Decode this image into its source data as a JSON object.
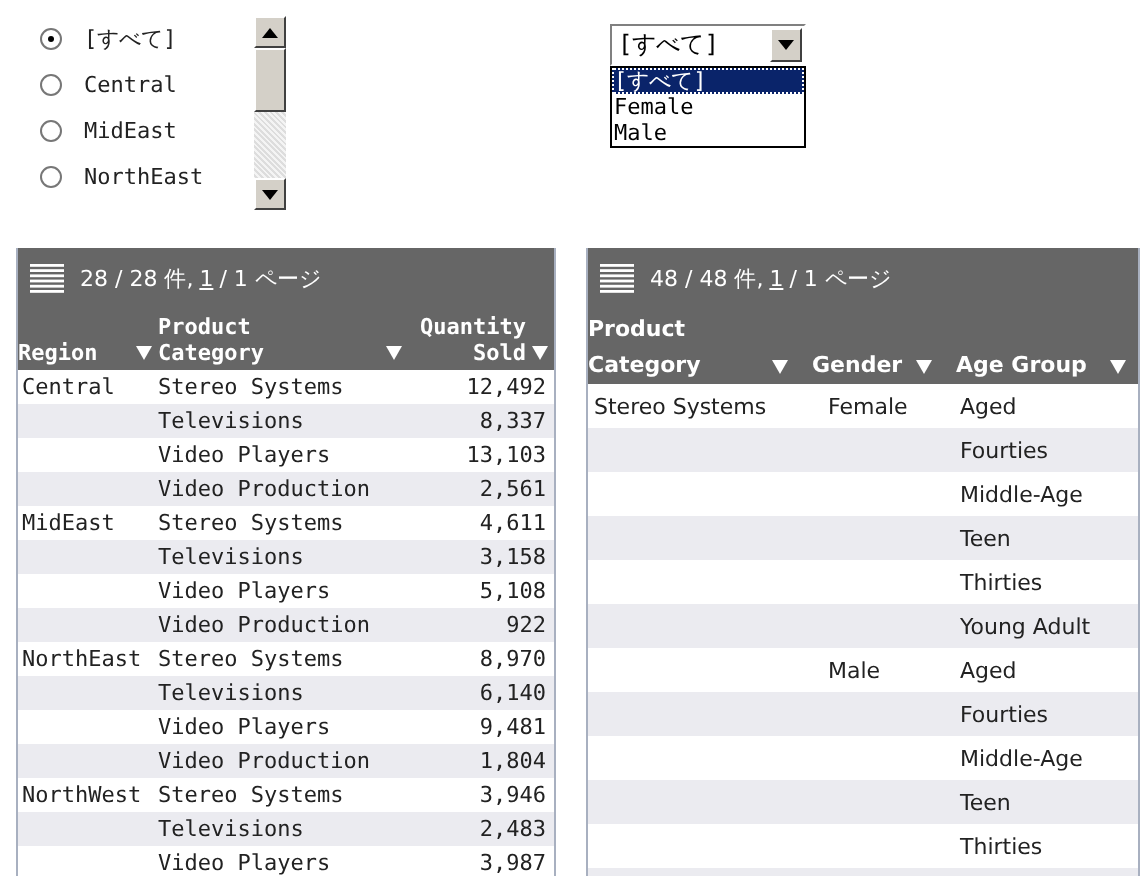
{
  "radios": [
    {
      "label": "[すべて]",
      "selected": true
    },
    {
      "label": "Central",
      "selected": false
    },
    {
      "label": "MidEast",
      "selected": false
    },
    {
      "label": "NorthEast",
      "selected": false
    }
  ],
  "dropdown": {
    "value": "[すべて]",
    "options": [
      {
        "label": "[すべて]",
        "selected": true
      },
      {
        "label": "Female",
        "selected": false
      },
      {
        "label": "Male",
        "selected": false
      }
    ]
  },
  "left_table": {
    "pager": {
      "count": "28 / 28 件,",
      "page": "1",
      "total": "/ 1 ページ"
    },
    "columns": [
      [
        "Region"
      ],
      [
        "Product",
        "Category"
      ],
      [
        "Quantity",
        "Sold"
      ]
    ],
    "rows": [
      {
        "region": "Central",
        "category": "Stereo Systems",
        "quantity": "12,492"
      },
      {
        "category": "Televisions",
        "quantity": "8,337"
      },
      {
        "category": "Video Players",
        "quantity": "13,103"
      },
      {
        "category": "Video Production",
        "quantity": "2,561"
      },
      {
        "region": "MidEast",
        "category": "Stereo Systems",
        "quantity": "4,611"
      },
      {
        "category": "Televisions",
        "quantity": "3,158"
      },
      {
        "category": "Video Players",
        "quantity": "5,108"
      },
      {
        "category": "Video Production",
        "quantity": "922"
      },
      {
        "region": "NorthEast",
        "category": "Stereo Systems",
        "quantity": "8,970"
      },
      {
        "category": "Televisions",
        "quantity": "6,140"
      },
      {
        "category": "Video Players",
        "quantity": "9,481"
      },
      {
        "category": "Video Production",
        "quantity": "1,804"
      },
      {
        "region": "NorthWest",
        "category": "Stereo Systems",
        "quantity": "3,946"
      },
      {
        "category": "Televisions",
        "quantity": "2,483"
      },
      {
        "category": "Video Players",
        "quantity": "3,987"
      }
    ]
  },
  "right_table": {
    "pager": {
      "count": "48 / 48 件,",
      "page": "1",
      "total": "/ 1 ページ"
    },
    "columns": [
      [
        "Product",
        "Category"
      ],
      [
        "Gender"
      ],
      [
        "Age Group"
      ]
    ],
    "rows": [
      {
        "category": "Stereo Systems",
        "gender": "Female",
        "age_group": "Aged"
      },
      {
        "age_group": "Fourties"
      },
      {
        "age_group": "Middle-Age"
      },
      {
        "age_group": "Teen"
      },
      {
        "age_group": "Thirties"
      },
      {
        "age_group": "Young Adult"
      },
      {
        "gender": "Male",
        "age_group": "Aged"
      },
      {
        "age_group": "Fourties"
      },
      {
        "age_group": "Middle-Age"
      },
      {
        "age_group": "Teen"
      },
      {
        "age_group": "Thirties"
      }
    ]
  }
}
